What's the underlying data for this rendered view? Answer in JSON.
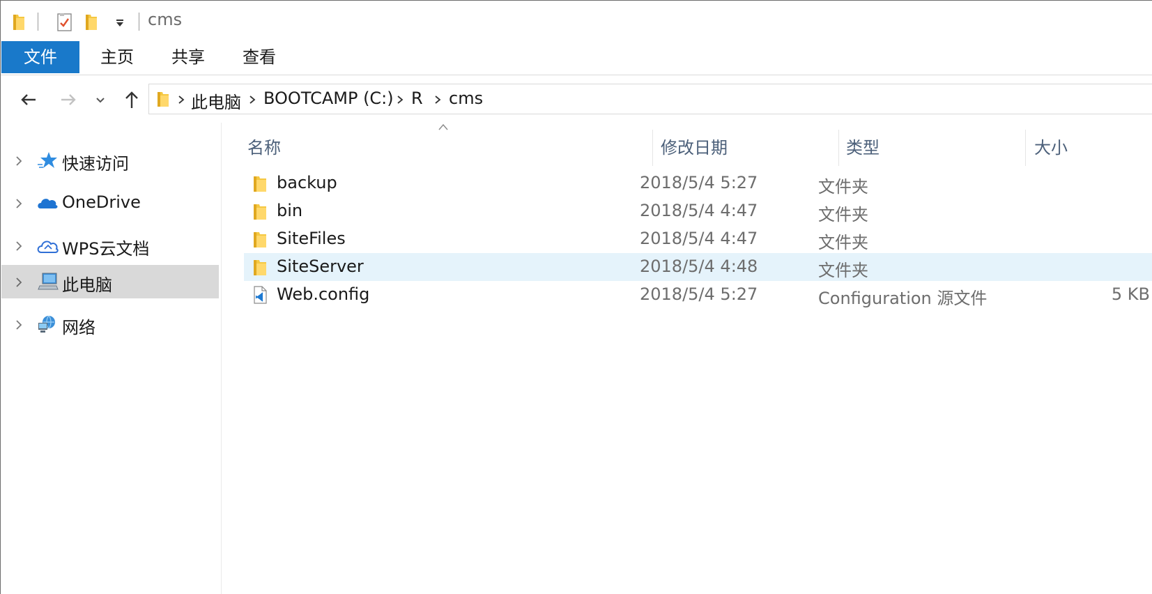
{
  "window": {
    "title": "cms"
  },
  "ribbon": {
    "tabs": [
      {
        "label": "文件"
      },
      {
        "label": "主页"
      },
      {
        "label": "共享"
      },
      {
        "label": "查看"
      }
    ]
  },
  "address": {
    "crumbs": [
      "此电脑",
      "BOOTCAMP (C:)",
      "R",
      "cms"
    ]
  },
  "navpane": {
    "items": [
      {
        "label": "快速访问",
        "icon": "star-icon"
      },
      {
        "label": "OneDrive",
        "icon": "cloud-icon"
      },
      {
        "label": "WPS云文档",
        "icon": "wps-cloud-icon"
      },
      {
        "label": "此电脑",
        "icon": "computer-icon",
        "selected": true
      },
      {
        "label": "网络",
        "icon": "network-icon"
      }
    ]
  },
  "filelist": {
    "columns": [
      "名称",
      "修改日期",
      "类型",
      "大小"
    ],
    "rows": [
      {
        "name": "backup",
        "date": "2018/5/4 5:27",
        "type": "文件夹",
        "size": "",
        "icon": "folder-icon"
      },
      {
        "name": "bin",
        "date": "2018/5/4 4:47",
        "type": "文件夹",
        "size": "",
        "icon": "folder-icon"
      },
      {
        "name": "SiteFiles",
        "date": "2018/5/4 4:47",
        "type": "文件夹",
        "size": "",
        "icon": "folder-icon"
      },
      {
        "name": "SiteServer",
        "date": "2018/5/4 4:48",
        "type": "文件夹",
        "size": "",
        "icon": "folder-icon",
        "hovered": true
      },
      {
        "name": "Web.config",
        "date": "2018/5/4 5:27",
        "type": "Configuration 源文件",
        "size": "5 KB",
        "icon": "vscode-file-icon"
      }
    ]
  },
  "colors": {
    "accent": "#1979ca",
    "header_text": "#4c607a",
    "hover_row": "#e5f3fb",
    "selected_nav": "#d9d9d9"
  }
}
